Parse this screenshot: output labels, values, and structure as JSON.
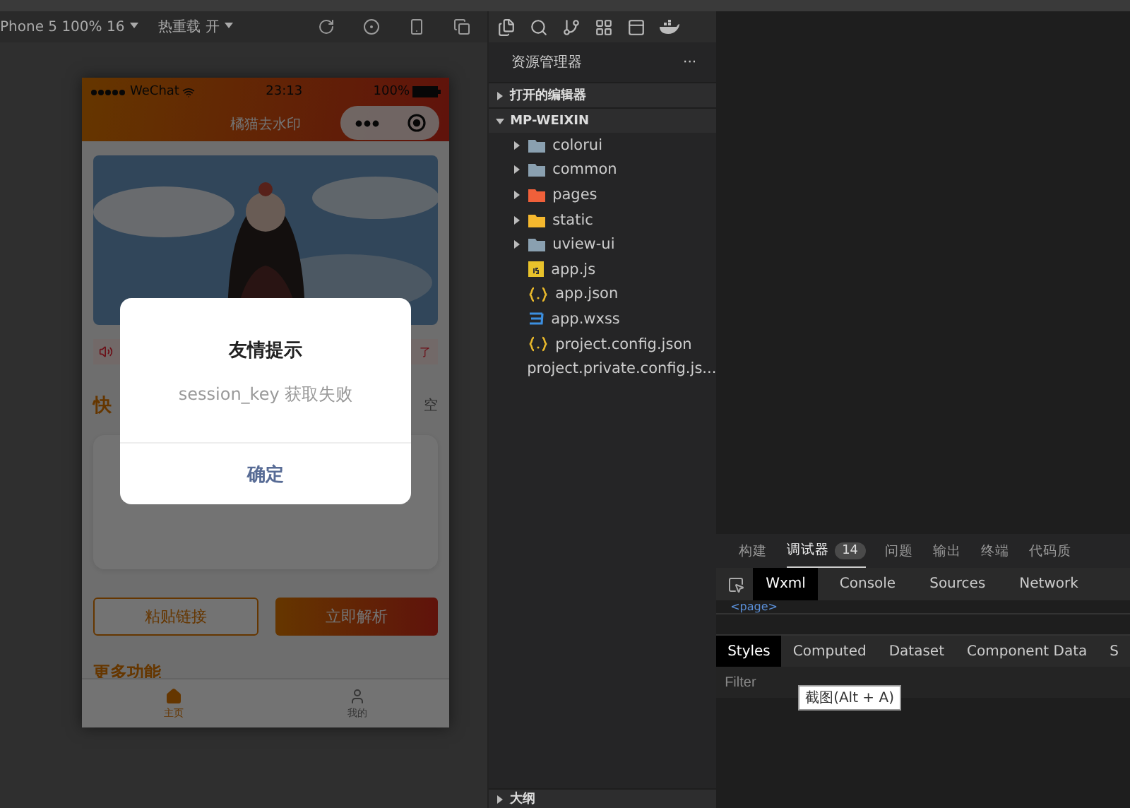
{
  "toolbar": {
    "device": "Phone 5 100% 16",
    "hot_reload": "热重载 开"
  },
  "phone": {
    "status": {
      "carrier": "WeChat",
      "time": "23:13",
      "battery": "100%"
    },
    "nav_title": "橘猫去水印",
    "notice_tail": "了",
    "section_head": "快",
    "section_action": "空",
    "buttons": [
      {
        "label": "粘贴链接",
        "kind": "outline"
      },
      {
        "label": "立即解析",
        "kind": "filled"
      }
    ],
    "more_title": "更多功能",
    "tabbar": [
      {
        "label": "主页",
        "selected": true
      },
      {
        "label": "我的",
        "selected": false
      }
    ]
  },
  "dialog": {
    "title": "友情提示",
    "message": "session_key 获取失败",
    "confirm": "确定"
  },
  "explorer": {
    "title": "资源管理器",
    "more": "···",
    "sections": [
      {
        "label": "打开的编辑器",
        "expanded": false
      },
      {
        "label": "MP-WEIXIN",
        "expanded": true
      }
    ],
    "tree": [
      {
        "name": "colorui",
        "kind": "folder",
        "color": "#8aa0b0",
        "expanded": false
      },
      {
        "name": "common",
        "kind": "folder",
        "color": "#8aa0b0",
        "expanded": false
      },
      {
        "name": "pages",
        "kind": "folder",
        "color": "#f0603a",
        "expanded": false
      },
      {
        "name": "static",
        "kind": "folder",
        "color": "#f5b82e",
        "expanded": false
      },
      {
        "name": "uview-ui",
        "kind": "folder",
        "color": "#8aa0b0",
        "expanded": false
      },
      {
        "name": "app.js",
        "kind": "js"
      },
      {
        "name": "app.json",
        "kind": "json"
      },
      {
        "name": "app.wxss",
        "kind": "css"
      },
      {
        "name": "project.config.json",
        "kind": "json"
      },
      {
        "name": "project.private.config.js...",
        "kind": "json"
      }
    ],
    "outline": {
      "label": "大纲",
      "expanded": false
    }
  },
  "debugger": {
    "panel_tabs": [
      {
        "label": "构建",
        "selected": false
      },
      {
        "label": "调试器",
        "selected": true,
        "badge": "14"
      },
      {
        "label": "问题",
        "selected": false
      },
      {
        "label": "输出",
        "selected": false
      },
      {
        "label": "终端",
        "selected": false
      },
      {
        "label": "代码质",
        "selected": false
      }
    ],
    "tabs": [
      {
        "label": "Wxml",
        "selected": true
      },
      {
        "label": "Console",
        "selected": false
      },
      {
        "label": "Sources",
        "selected": false
      },
      {
        "label": "Network",
        "selected": false
      }
    ],
    "node": "<page>",
    "style_tabs": [
      {
        "label": "Styles",
        "selected": true
      },
      {
        "label": "Computed",
        "selected": false
      },
      {
        "label": "Dataset",
        "selected": false
      },
      {
        "label": "Component Data",
        "selected": false
      },
      {
        "label": "S",
        "selected": false
      }
    ],
    "filter_placeholder": "Filter",
    "tooltip": "截图(Alt + A)"
  }
}
